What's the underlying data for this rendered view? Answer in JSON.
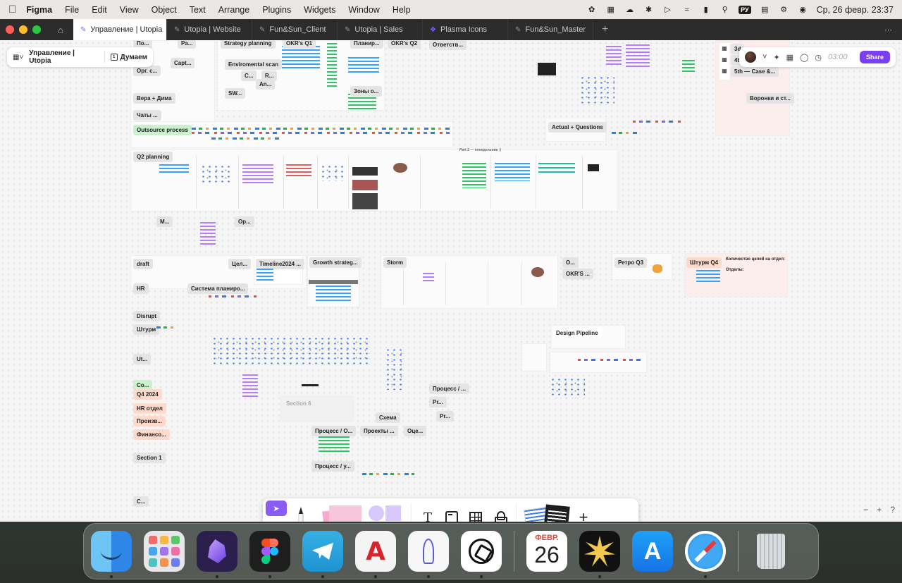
{
  "menubar": {
    "app_name": "Figma",
    "menus": [
      "File",
      "Edit",
      "View",
      "Object",
      "Text",
      "Arrange",
      "Plugins",
      "Widgets",
      "Window",
      "Help"
    ],
    "keyboard_layout": "РУ",
    "clock": "Ср, 26 февр.  23:37"
  },
  "tabs": {
    "active": "Управление | Utopia",
    "others": [
      "Utopia | Website",
      "Fun&Sun_Client",
      "Utopia | Sales",
      "Plasma Icons",
      "Fun&Sun_Master"
    ]
  },
  "file_panel": {
    "file_name": "Управление | Utopia",
    "page_name": "Думаем"
  },
  "right_panel": {
    "timer": "03:00",
    "share_label": "Share",
    "accent": "#7b3ff2"
  },
  "canvas_labels": {
    "strategy_planning": "Strategy planning",
    "okrs_q1": "OKR's Q1",
    "planir": "Планир...",
    "okrs_q2": "OKR's Q2",
    "otvetstv": "Ответств...",
    "po": "По...",
    "pa": "Pa...",
    "capt": "Capt...",
    "org": "Орг. с...",
    "enviro": "Enviromental scan",
    "c1": "C...",
    "r1": "R...",
    "an": "An...",
    "sw": "SW...",
    "zony": "Зоны о...",
    "vera": "Вера + Дима",
    "chaty": "Чаты ...",
    "outsource": "Outsource process",
    "actual": "Actual + Questions",
    "q2planning": "Q2 planning",
    "part2": "Part 2 — понедельник :)",
    "m": "М...",
    "op": "Ор...",
    "draft": "draft",
    "cel": "Цел...",
    "timeline": "Timeline2024 ...",
    "growth": "Growth strateg...",
    "storm": "Storm",
    "o1": "О...",
    "okrs2": "OKR'S ...",
    "retro": "Ретро Q3",
    "shturm_q4": "Штурм Q4",
    "goals_count": "Количество целей на отдел:",
    "departments": "Отделы:",
    "hr": "HR",
    "sistema": "Система планиро...",
    "disrupt": "Disrupt",
    "shturm": "Штурм",
    "design_pipeline": "Design Pipeline",
    "ut": "Ut...",
    "co": "Co...",
    "q4_2024": "Q4 2024",
    "hr_otdel": "HR отдел",
    "proizv": "Произв...",
    "finans": "Финансо...",
    "section6": "Section 6",
    "process1": "Процесс / ...",
    "pr1": "Pr...",
    "pr2": "Pr...",
    "skhema": "Схема",
    "process_o": "Процесс / О...",
    "proekty": "Проекты ...",
    "ots": "Оце...",
    "section1": "Section 1",
    "process_u": "Процесс / у...",
    "c_bottom": "С...",
    "d3": "3d",
    "d4": "4t",
    "case5": "5th — Case &...",
    "voronki": "Воронки и ст..."
  },
  "zoom": {
    "minus": "−",
    "plus": "+",
    "help": "?"
  },
  "dock": {
    "calendar_month": "ФЕВР.",
    "calendar_day": "26",
    "apps": [
      "Finder",
      "Launchpad",
      "Obsidian",
      "Figma",
      "Telegram",
      "Acrobat",
      "Rocket",
      "ChatGPT",
      "Calendar",
      "Spark",
      "App Store",
      "Safari",
      "Trash"
    ]
  }
}
